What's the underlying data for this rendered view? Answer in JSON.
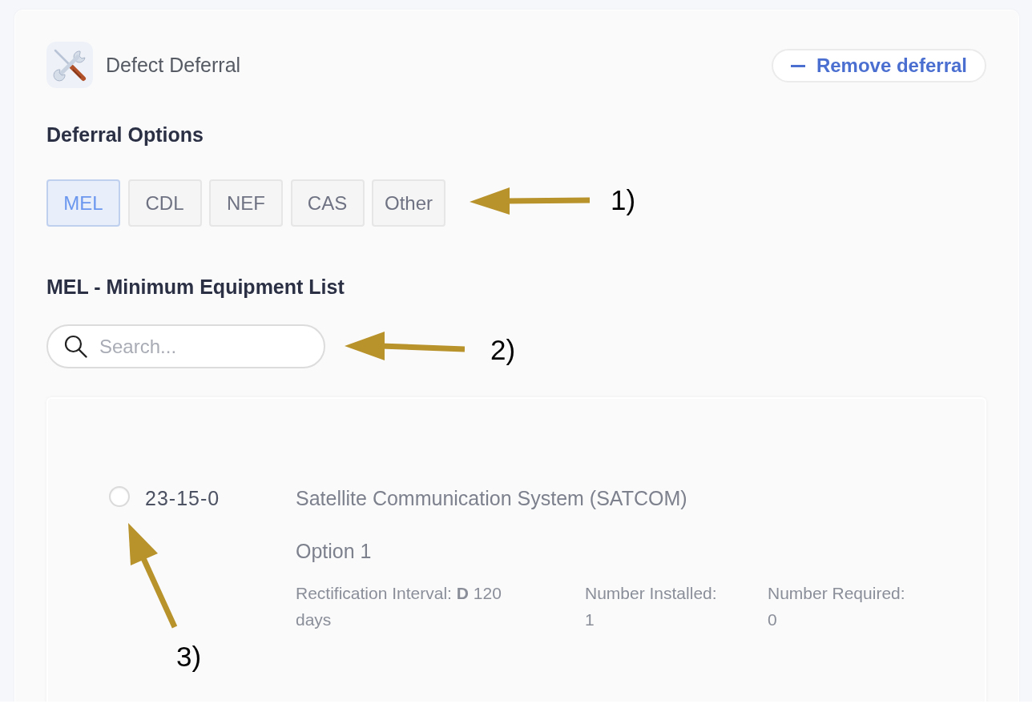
{
  "header": {
    "title": "Defect Deferral",
    "remove_button": {
      "label": "Remove deferral"
    }
  },
  "deferral_options": {
    "heading": "Deferral Options",
    "tabs": [
      {
        "label": "MEL",
        "selected": true
      },
      {
        "label": "CDL",
        "selected": false
      },
      {
        "label": "NEF",
        "selected": false
      },
      {
        "label": "CAS",
        "selected": false
      },
      {
        "label": "Other",
        "selected": false
      }
    ]
  },
  "equipment_list": {
    "heading": "MEL - Minimum Equipment List",
    "search": {
      "placeholder": "Search..."
    },
    "items": [
      {
        "selected": false,
        "code": "23-15-0",
        "title": "Satellite Communication System (SATCOM)",
        "option": "Option 1",
        "details": [
          "Rectification Interval: **D** 120 days",
          "Number Installed: 1",
          "Number Required: 0"
        ]
      }
    ]
  },
  "annotations": [
    {
      "label": "1)"
    },
    {
      "label": "2)"
    },
    {
      "label": "3)"
    }
  ]
}
